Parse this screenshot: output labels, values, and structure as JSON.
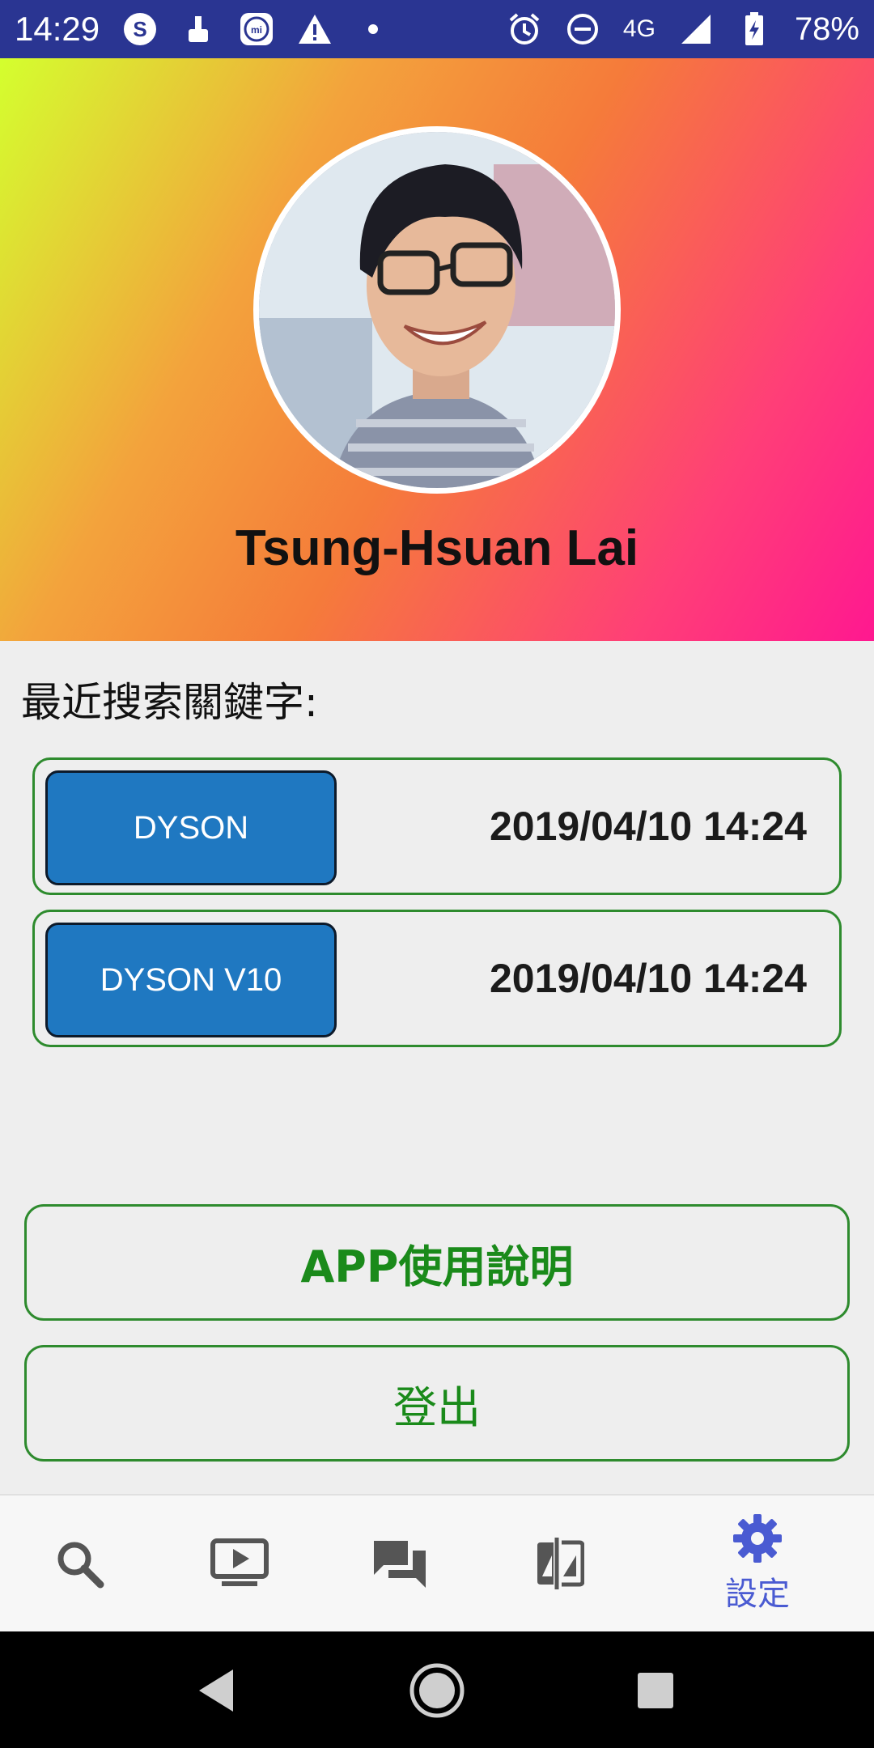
{
  "status_bar": {
    "time": "14:29",
    "network": "4G",
    "battery": "78%",
    "icons_left": [
      "s-icon",
      "broom-icon",
      "mi-icon",
      "warning-icon",
      "dot-icon"
    ],
    "icons_right": [
      "alarm-icon",
      "dnd-icon",
      "signal-icon",
      "battery-charging-icon"
    ],
    "background_color": "#2a3592"
  },
  "profile": {
    "name": "Tsung-Hsuan Lai",
    "gradient_colors": [
      "#d4ff2e",
      "#f57b3a",
      "#ff1890"
    ]
  },
  "recent_search": {
    "title": "最近搜索關鍵字:",
    "items": [
      {
        "keyword": "DYSON",
        "time": "2019/04/10 14:24"
      },
      {
        "keyword": "DYSON V10",
        "time": "2019/04/10 14:24"
      }
    ],
    "keyword_button_color": "#1f78c1",
    "border_color": "#2e8b2e"
  },
  "actions": {
    "help_label": "APP使用說明",
    "logout_label": "登出",
    "text_color": "#1a8a1a"
  },
  "bottom_nav": {
    "items": [
      {
        "icon": "search-icon"
      },
      {
        "icon": "video-icon"
      },
      {
        "icon": "chat-icon"
      },
      {
        "icon": "compare-icon"
      },
      {
        "icon": "gear-icon",
        "label": "設定",
        "active": true
      }
    ],
    "active_color": "#4a5bd2"
  },
  "system_nav": {
    "icons": [
      "back-icon",
      "home-icon",
      "recents-icon"
    ]
  }
}
